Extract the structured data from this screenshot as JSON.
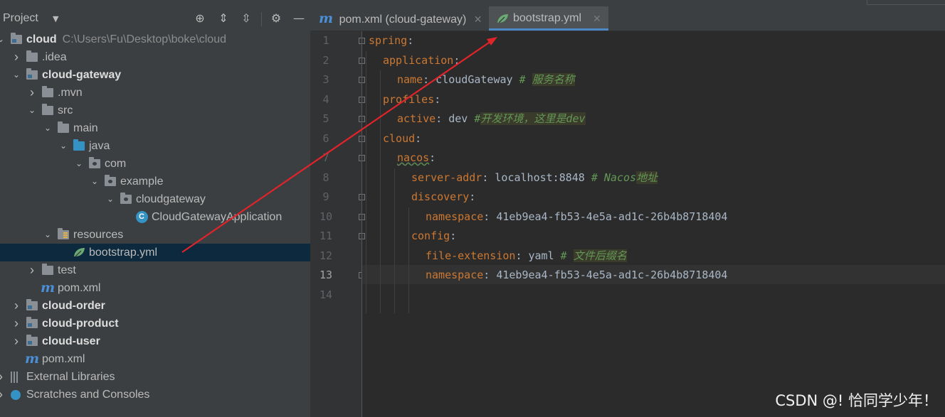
{
  "project_panel": {
    "title": "Project",
    "tools": [
      "target-icon",
      "expand-all-icon",
      "collapse-all-icon",
      "gear-icon",
      "minimize-icon"
    ],
    "tree": [
      {
        "label": "cloud",
        "path": "C:\\Users\\Fu\\Desktop\\boke\\cloud",
        "bold": true,
        "icon": "module-icon",
        "depth": 0,
        "arrow": "down"
      },
      {
        "label": ".idea",
        "icon": "folder-icon",
        "depth": 1,
        "arrow": "right"
      },
      {
        "label": "cloud-gateway",
        "bold": true,
        "icon": "module-icon",
        "depth": 1,
        "arrow": "down"
      },
      {
        "label": ".mvn",
        "icon": "folder-icon",
        "depth": 2,
        "arrow": "right"
      },
      {
        "label": "src",
        "icon": "folder-icon",
        "depth": 2,
        "arrow": "down"
      },
      {
        "label": "main",
        "icon": "folder-icon",
        "depth": 3,
        "arrow": "down"
      },
      {
        "label": "java",
        "icon": "source-folder-icon",
        "depth": 4,
        "arrow": "down"
      },
      {
        "label": "com",
        "icon": "package-icon",
        "depth": 5,
        "arrow": "down"
      },
      {
        "label": "example",
        "icon": "package-icon",
        "depth": 6,
        "arrow": "down"
      },
      {
        "label": "cloudgateway",
        "icon": "package-icon",
        "depth": 7,
        "arrow": "down"
      },
      {
        "label": "CloudGatewayApplication",
        "icon": "spring-class-icon",
        "depth": 8,
        "arrow": ""
      },
      {
        "label": "resources",
        "icon": "resources-folder-icon",
        "depth": 3,
        "arrow": "down"
      },
      {
        "label": "bootstrap.yml",
        "icon": "spring-leaf-icon",
        "depth": 4,
        "arrow": "",
        "selected": true
      },
      {
        "label": "test",
        "icon": "folder-icon",
        "depth": 2,
        "arrow": "right"
      },
      {
        "label": "pom.xml",
        "icon": "maven-icon",
        "depth": 2,
        "arrow": ""
      },
      {
        "label": "cloud-order",
        "bold": true,
        "icon": "module-icon",
        "depth": 1,
        "arrow": "right"
      },
      {
        "label": "cloud-product",
        "bold": true,
        "icon": "module-icon",
        "depth": 1,
        "arrow": "right"
      },
      {
        "label": "cloud-user",
        "bold": true,
        "icon": "module-icon",
        "depth": 1,
        "arrow": "right"
      },
      {
        "label": "pom.xml",
        "icon": "maven-icon",
        "depth": 1,
        "arrow": ""
      },
      {
        "label": "External Libraries",
        "icon": "libraries-icon",
        "depth": 0,
        "arrow": "right"
      },
      {
        "label": "Scratches and Consoles",
        "icon": "scratches-icon",
        "depth": 0,
        "arrow": "right"
      }
    ]
  },
  "editor": {
    "tabs": [
      {
        "label": "pom.xml (cloud-gateway)",
        "icon": "maven-icon",
        "active": false
      },
      {
        "label": "bootstrap.yml",
        "icon": "spring-leaf-icon",
        "active": true
      }
    ],
    "current_line": 13,
    "lines": [
      {
        "n": "1",
        "indent": 0,
        "key": "spring",
        "value": "",
        "comment": ""
      },
      {
        "n": "2",
        "indent": 1,
        "key": "application",
        "value": "",
        "comment": ""
      },
      {
        "n": "3",
        "indent": 2,
        "key": "name",
        "value": "cloudGateway",
        "comment": "# 服务名称"
      },
      {
        "n": "4",
        "indent": 1,
        "key": "profiles",
        "value": "",
        "comment": ""
      },
      {
        "n": "5",
        "indent": 2,
        "key": "active",
        "value": "dev",
        "comment": "#开发环境，这里是dev"
      },
      {
        "n": "6",
        "indent": 1,
        "key": "cloud",
        "value": "",
        "comment": ""
      },
      {
        "n": "7",
        "indent": 2,
        "key": "nacos",
        "value": "",
        "comment": ""
      },
      {
        "n": "8",
        "indent": 3,
        "key": "server-addr",
        "value": "localhost:8848",
        "comment": "# Nacos地址"
      },
      {
        "n": "9",
        "indent": 3,
        "key": "discovery",
        "value": "",
        "comment": ""
      },
      {
        "n": "10",
        "indent": 4,
        "key": "namespace",
        "value": "41eb9ea4-fb53-4e5a-ad1c-26b4b8718404",
        "comment": ""
      },
      {
        "n": "11",
        "indent": 3,
        "key": "config",
        "value": "",
        "comment": ""
      },
      {
        "n": "12",
        "indent": 4,
        "key": "file-extension",
        "value": "yaml",
        "comment": "# 文件后缀名"
      },
      {
        "n": "13",
        "indent": 4,
        "key": "namespace",
        "value": "41eb9ea4-fb53-4e5a-ad1c-26b4b8718404",
        "comment": ""
      },
      {
        "n": "14",
        "indent": 0,
        "key": "",
        "value": "",
        "comment": ""
      }
    ]
  },
  "annotation": {
    "color": "#e0242a"
  },
  "watermark": "CSDN @! 恰同学少年！",
  "colors": {
    "key": "#cc7832",
    "value": "#a9b7c6",
    "comment": "#629755",
    "selection": "#0d293e",
    "accent": "#4a88c7"
  }
}
